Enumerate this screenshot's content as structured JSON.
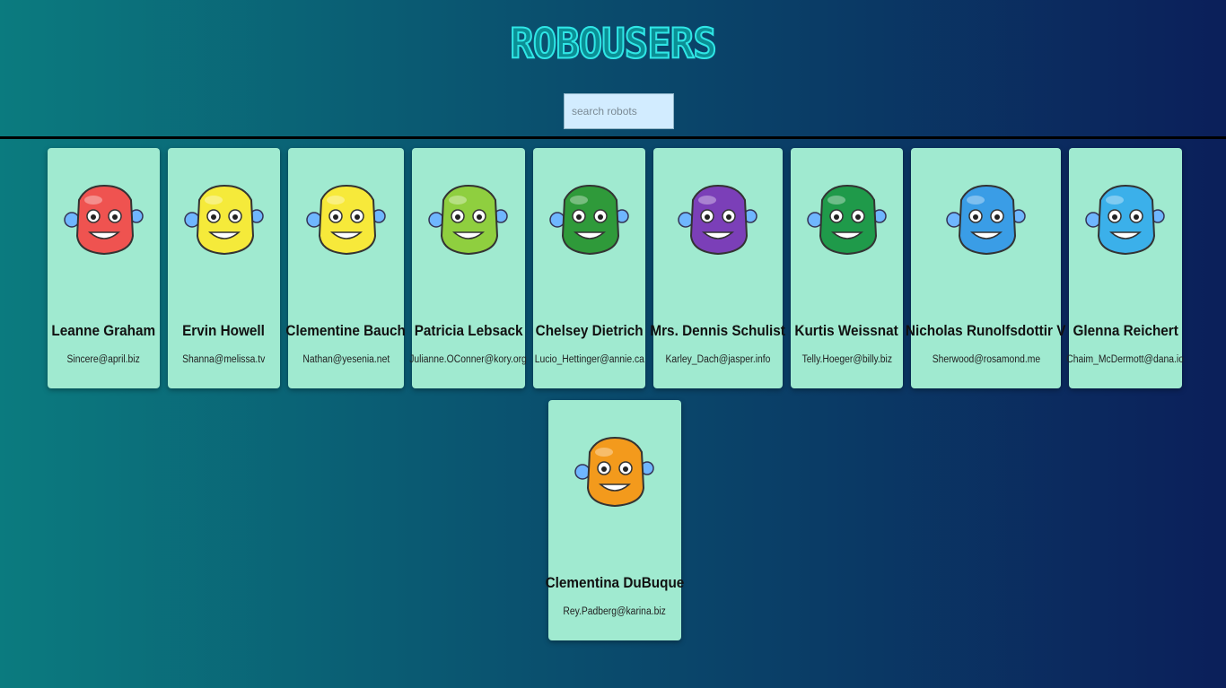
{
  "header": {
    "title": "ROBOUSERS",
    "search_placeholder": "search robots",
    "search_value": ""
  },
  "robots": [
    {
      "name": "Leanne Graham",
      "email": "Sincere@april.biz",
      "color": "#ef5350"
    },
    {
      "name": "Ervin Howell",
      "email": "Shanna@melissa.tv",
      "color": "#f5ea3a"
    },
    {
      "name": "Clementine Bauch",
      "email": "Nathan@yesenia.net",
      "color": "#f7e93a"
    },
    {
      "name": "Patricia Lebsack",
      "email": "Julianne.OConner@kory.org",
      "color": "#8fcf3f"
    },
    {
      "name": "Chelsey Dietrich",
      "email": "Lucio_Hettinger@annie.ca",
      "color": "#2f9a3a"
    },
    {
      "name": "Mrs. Dennis Schulist",
      "email": "Karley_Dach@jasper.info",
      "color": "#7b3fb8"
    },
    {
      "name": "Kurtis Weissnat",
      "email": "Telly.Hoeger@billy.biz",
      "color": "#1f9a4a"
    },
    {
      "name": "Nicholas Runolfsdottir V",
      "email": "Sherwood@rosamond.me",
      "color": "#3a9de6"
    },
    {
      "name": "Glenna Reichert",
      "email": "Chaim_McDermott@dana.io",
      "color": "#3bb0ea"
    },
    {
      "name": "Clementina DuBuque",
      "email": "Rey.Padberg@karina.biz",
      "color": "#f39a1c"
    }
  ]
}
